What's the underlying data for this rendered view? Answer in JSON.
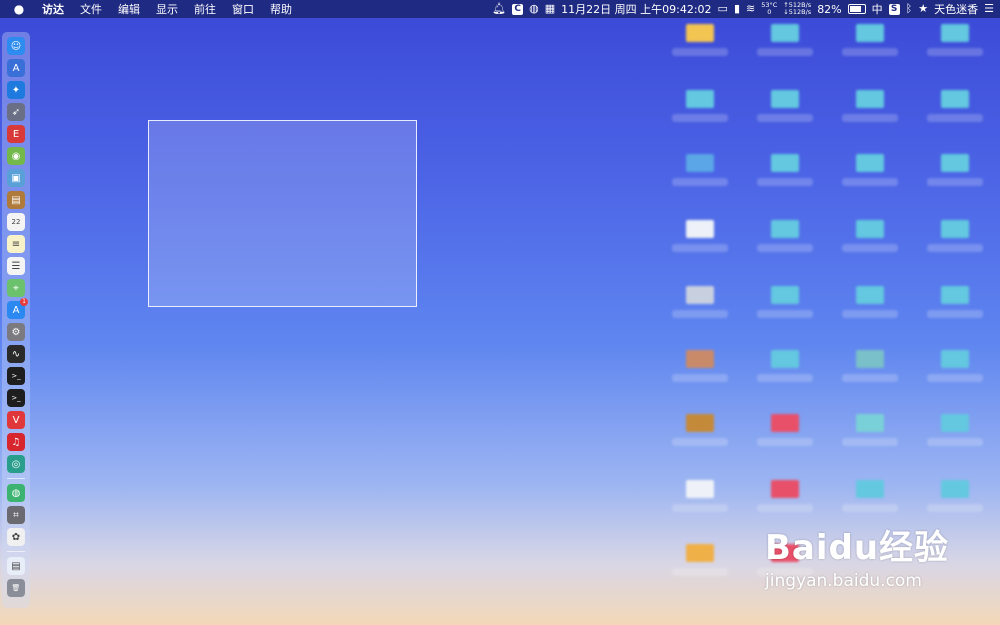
{
  "menubar": {
    "app_name": "访达",
    "menus": [
      "文件",
      "编辑",
      "显示",
      "前往",
      "窗口",
      "帮助"
    ],
    "status": {
      "temp": "53°C",
      "temp_sub": "0",
      "net_up": "↑512B/s",
      "net_down": "↓512B/s",
      "datetime": "11月22日 周四 上午09:42:02",
      "battery": "82%",
      "battery_level": 0.82,
      "ime": "中",
      "user": "天色迷香"
    }
  },
  "dock": {
    "items": [
      {
        "name": "finder",
        "color": "#2e8cf0",
        "glyph": "☺"
      },
      {
        "name": "launchpad",
        "color": "#3b6fd8",
        "glyph": "A"
      },
      {
        "name": "safari",
        "color": "#1f7ae0",
        "glyph": "✦"
      },
      {
        "name": "rocket",
        "color": "#6b6f85",
        "glyph": "➶"
      },
      {
        "name": "app-red",
        "color": "#d83a3a",
        "glyph": "E"
      },
      {
        "name": "android",
        "color": "#72b84a",
        "glyph": "◉"
      },
      {
        "name": "preview",
        "color": "#5aa0d8",
        "glyph": "▣"
      },
      {
        "name": "notebook",
        "color": "#b07a3a",
        "glyph": "▤"
      },
      {
        "name": "calendar",
        "color": "#f4f4f4",
        "glyph": "22"
      },
      {
        "name": "notes",
        "color": "#f8f2c8",
        "glyph": "≡"
      },
      {
        "name": "reminders",
        "color": "#f4f4f4",
        "glyph": "☰"
      },
      {
        "name": "maps",
        "color": "#6cc26c",
        "glyph": "⌖"
      },
      {
        "name": "app-store",
        "color": "#2a88f0",
        "glyph": "A",
        "badge": "1"
      },
      {
        "name": "system-preferences",
        "color": "#7a7a80",
        "glyph": "⚙"
      },
      {
        "name": "activity-monitor",
        "color": "#2a2a2a",
        "glyph": "∿"
      },
      {
        "name": "terminal-1",
        "color": "#1e1e1e",
        "glyph": ">_"
      },
      {
        "name": "terminal-2",
        "color": "#1e1e1e",
        "glyph": ">_"
      },
      {
        "name": "vivaldi",
        "color": "#e0383a",
        "glyph": "V"
      },
      {
        "name": "netease-music",
        "color": "#d8262e",
        "glyph": "♫"
      },
      {
        "name": "teal-app",
        "color": "#2a9e8c",
        "glyph": "◎"
      },
      {
        "name": "wechat",
        "color": "#3cb371",
        "glyph": "◍"
      },
      {
        "name": "screenshot",
        "color": "#6a6a70",
        "glyph": "⌗"
      },
      {
        "name": "photos",
        "color": "#f0f0f0",
        "glyph": "✿"
      },
      {
        "name": "documents",
        "color": "#e8eef8",
        "glyph": "▤"
      },
      {
        "name": "trash",
        "color": "#8a8e98",
        "glyph": "🗑"
      }
    ]
  },
  "watermark": {
    "logo": "Baidu经验",
    "url": "jingyan.baidu.com"
  }
}
